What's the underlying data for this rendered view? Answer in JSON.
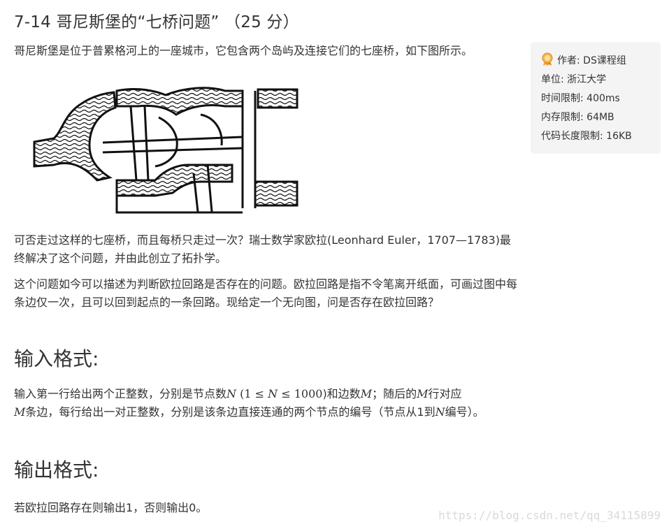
{
  "problem": {
    "title": "7-14 哥尼斯堡的“七桥问题” （25 分）",
    "intro": "哥尼斯堡是位于普累格河上的一座城市，它包含两个岛屿及连接它们的七座桥，如下图所示。",
    "paragraph2": "可否走过这样的七座桥，而且每桥只走过一次？瑞士数学家欧拉(Leonhard Euler，1707—1783)最终解决了这个问题，并由此创立了拓扑学。",
    "paragraph3": "这个问题如今可以描述为判断欧拉回路是否存在的问题。欧拉回路是指不令笔离开纸面，可画过图中每条边仅一次，且可以回到起点的一条回路。现给定一个无向图，问是否存在欧拉回路？"
  },
  "input_section": {
    "heading": "输入格式:",
    "t1": "输入第一行给出两个正整数，分别是节点数",
    "var_n": "N",
    "t2": " (",
    "one": "1",
    "le": "≤",
    "thousand": "1000",
    "t3": ")和边数",
    "var_m": "M",
    "t4": "；随后的",
    "t5": "行对应",
    "t6": "条边，每行给出一对正整数，分别是该条边直接连通的两个节点的编号（节点从1到",
    "t7": "编号）。"
  },
  "output_section": {
    "heading": "输出格式:",
    "text": "若欧拉回路存在则输出1，否则输出0。"
  },
  "info_card": {
    "author": "作者: DS课程组",
    "unit": "单位: 浙江大学",
    "time_limit": "时间限制: 400ms",
    "memory_limit": "内存限制: 64MB",
    "code_limit": "代码长度限制: 16KB"
  },
  "watermark": "https://blog.csdn.net/qq_34115899"
}
